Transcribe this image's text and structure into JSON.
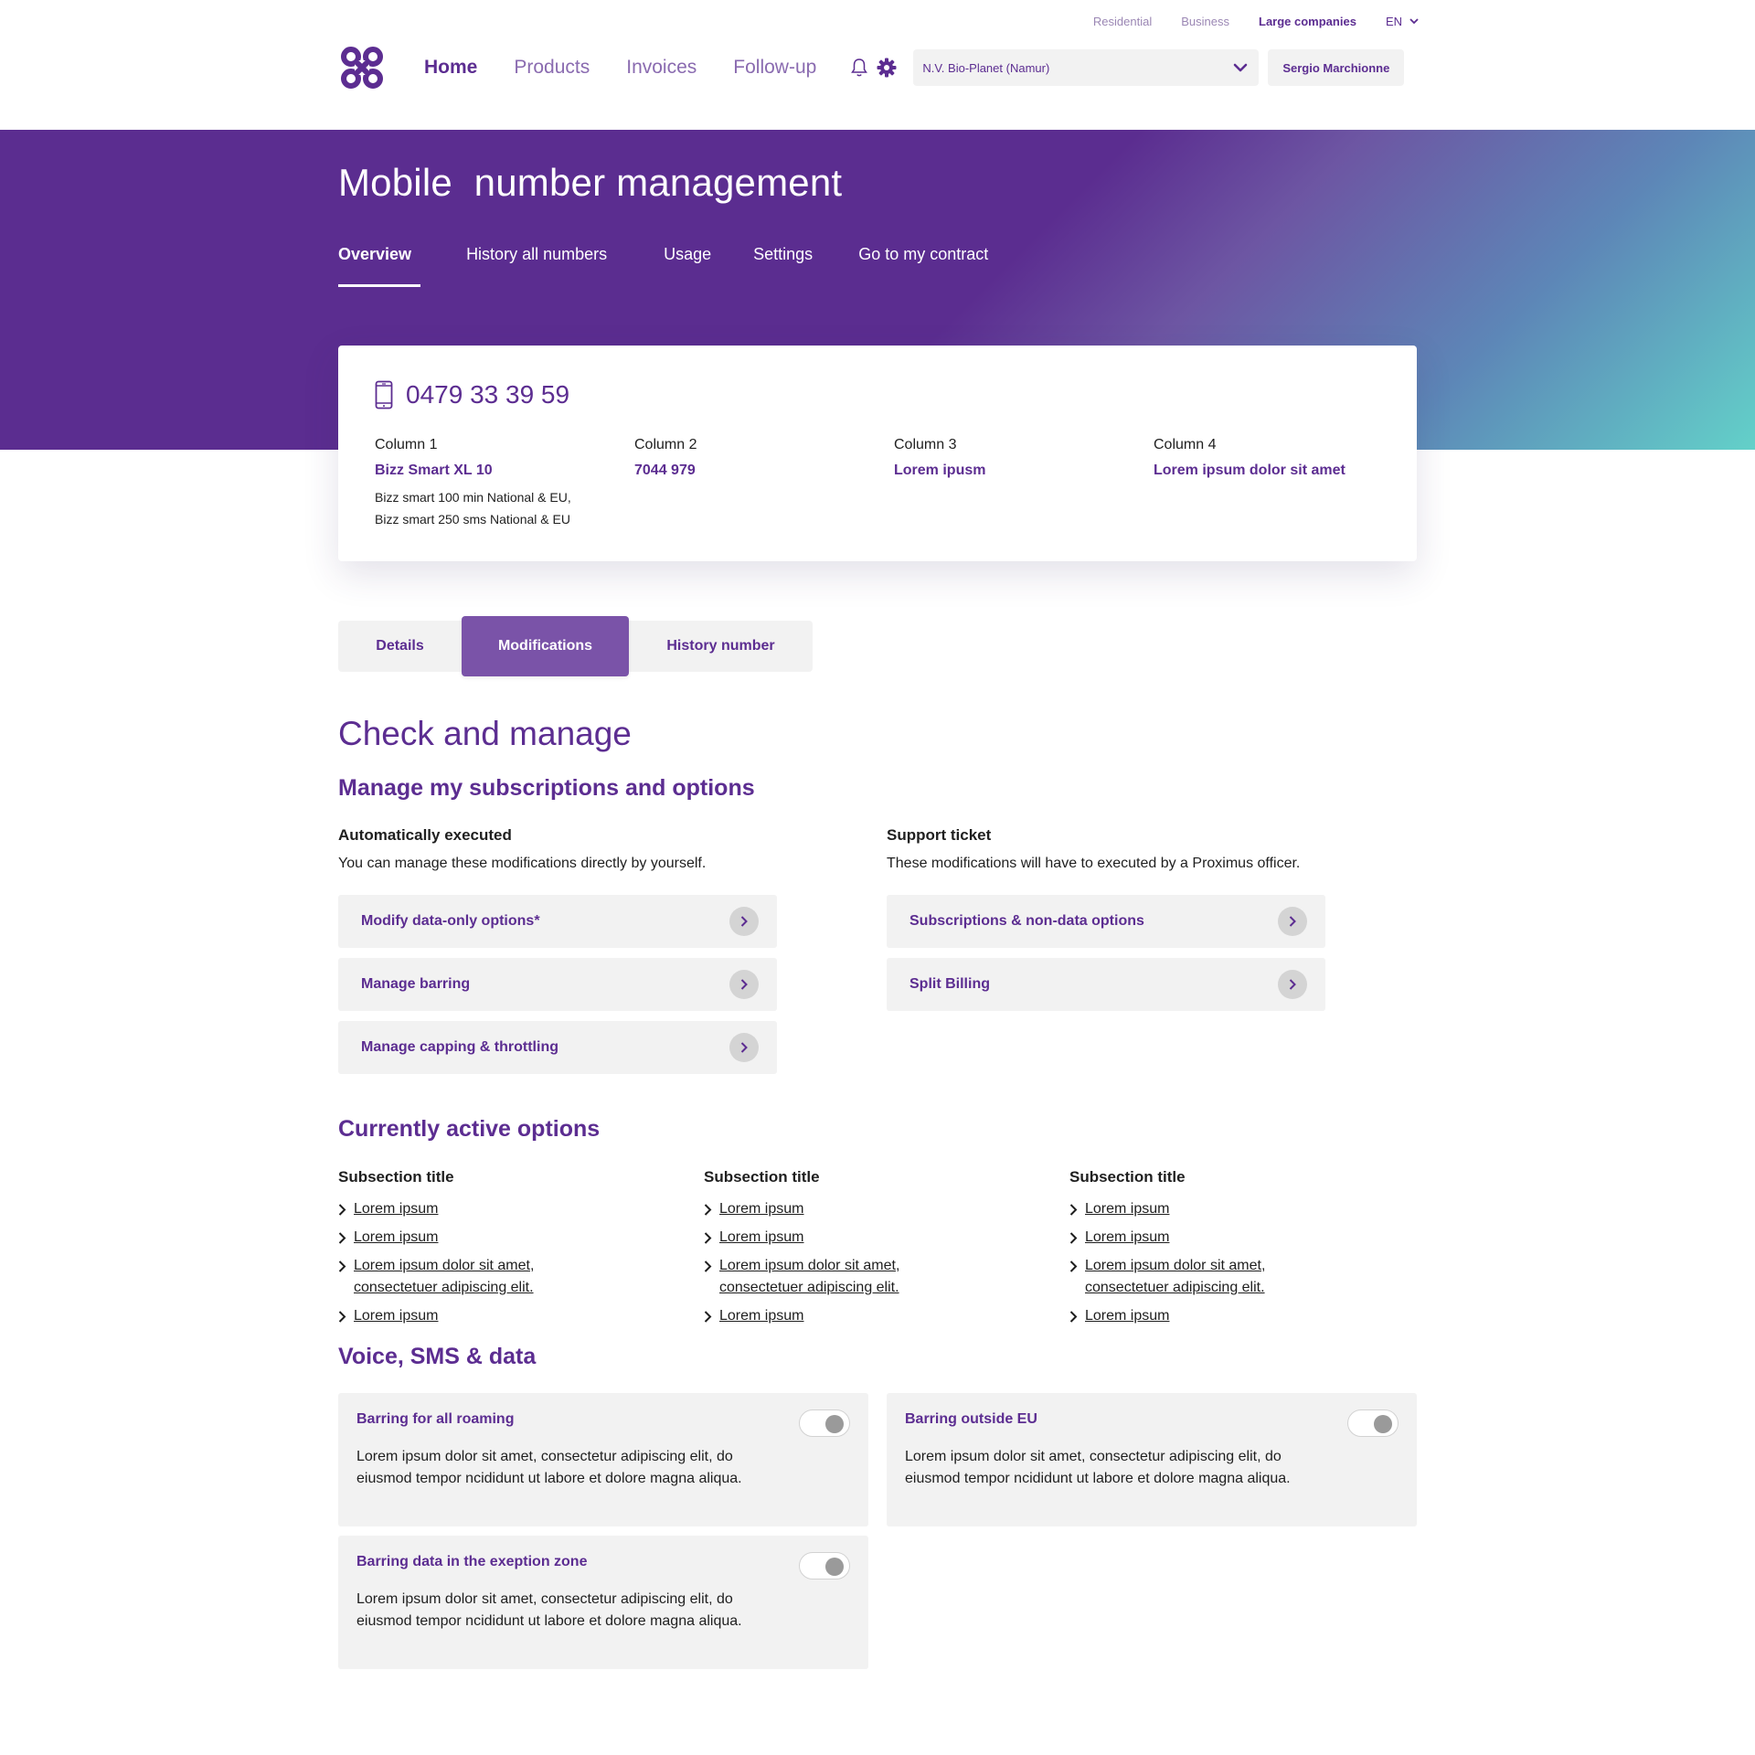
{
  "utility_nav": {
    "items": [
      "Residential",
      "Business",
      "Large companies"
    ],
    "active": "Large companies",
    "language": "EN"
  },
  "header": {
    "nav": [
      "Home",
      "Products",
      "Invoices",
      "Follow-up"
    ],
    "active_nav": "Home",
    "company_selector": "N.V. Bio-Planet (Namur)",
    "user": "Sergio Marchionne"
  },
  "hero": {
    "title": "Mobile  number management",
    "tabs": [
      "Overview",
      "History all numbers",
      "Usage",
      "Settings",
      "Go to my contract"
    ],
    "active_tab": "Overview"
  },
  "number_card": {
    "number": "0479 33 39 59",
    "columns": [
      {
        "header": "Column 1",
        "value": "Bizz Smart XL 10",
        "detail_1": "Bizz smart 100 min National & EU,",
        "detail_2": "Bizz smart 250 sms National & EU"
      },
      {
        "header": "Column 2",
        "value": "7044 979"
      },
      {
        "header": "Column 3",
        "value": "Lorem ipusm"
      },
      {
        "header": "Column 4",
        "value": "Lorem ipsum dolor sit amet"
      }
    ]
  },
  "segments": {
    "items": [
      "Details",
      "Modifications",
      "History number"
    ],
    "active": "Modifications"
  },
  "check_manage": {
    "title": "Check and manage",
    "subtitle": "Manage my subscriptions and options",
    "auto": {
      "title": "Automatically executed",
      "description": "You can manage these modifications directly by yourself.",
      "actions": [
        "Modify data-only options*",
        "Manage barring",
        "Manage capping & throttling"
      ]
    },
    "support": {
      "title": "Support ticket",
      "description": "These modifications will have to executed by a Proximus officer.",
      "actions": [
        "Subscriptions & non-data options",
        "Split Billing"
      ]
    }
  },
  "active_options": {
    "title": "Currently active options",
    "columns": [
      {
        "title": "Subsection title",
        "links": [
          "Lorem ipsum",
          "Lorem ipsum",
          "Lorem ipsum dolor sit amet, consectetuer adipiscing elit.",
          "Lorem ipsum"
        ]
      },
      {
        "title": "Subsection title",
        "links": [
          "Lorem ipsum",
          "Lorem ipsum",
          "Lorem ipsum dolor sit amet, consectetuer adipiscing elit.",
          "Lorem ipsum"
        ]
      },
      {
        "title": "Subsection title",
        "links": [
          "Lorem ipsum",
          "Lorem ipsum",
          "Lorem ipsum dolor sit amet, consectetuer adipiscing elit.",
          "Lorem ipsum"
        ]
      }
    ]
  },
  "voice_sms_data": {
    "title": "Voice, SMS & data",
    "options": [
      {
        "title": "Barring for all roaming",
        "description": "Lorem ipsum dolor sit amet, consectetur adipiscing elit, do eiusmod tempor ncididunt ut labore et dolore magna aliqua.",
        "enabled": false
      },
      {
        "title": "Barring outside EU",
        "description": "Lorem ipsum dolor sit amet, consectetur adipiscing elit, do eiusmod tempor ncididunt ut labore et dolore magna aliqua.",
        "enabled": false
      },
      {
        "title": "Barring data in the exeption zone",
        "description": "Lorem ipsum dolor sit amet, consectetur adipiscing elit, do eiusmod tempor ncididunt ut labore et dolore magna aliqua.",
        "enabled": false
      }
    ]
  },
  "colors": {
    "brand_purple": "#5c2d91",
    "segment_active": "#7a53a8",
    "panel_grey": "#f2f2f2",
    "gradient_teal": "#63d1c9"
  },
  "icons": [
    "logo-icon",
    "chevron-down-icon",
    "bell-icon",
    "gear-icon",
    "phone-icon",
    "chevron-right-icon"
  ]
}
